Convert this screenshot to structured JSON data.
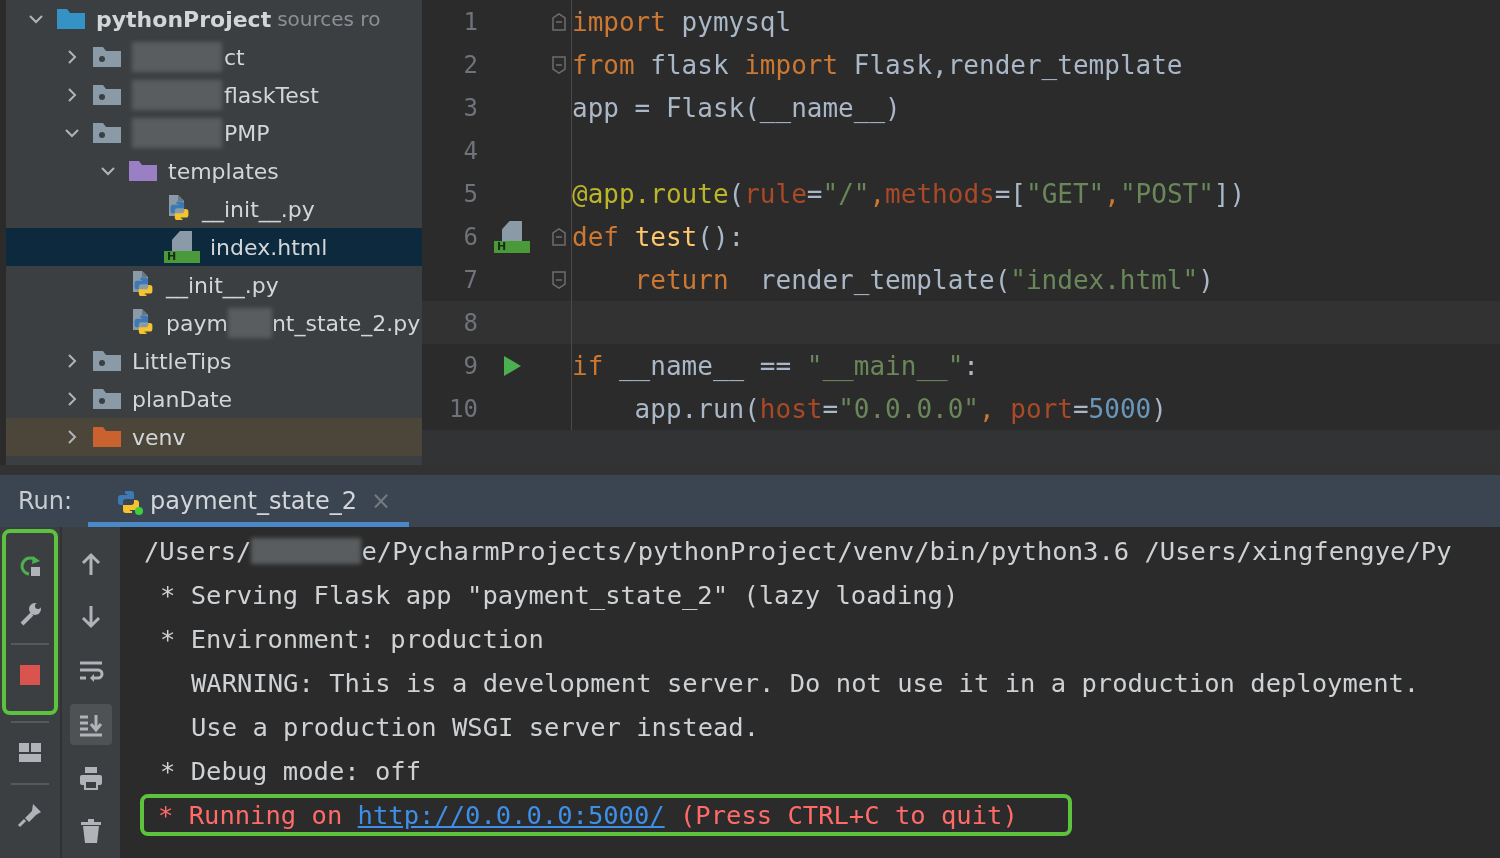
{
  "project_tree": {
    "items": [
      {
        "label": "pythonProject",
        "note": "sources ro",
        "kind": "root",
        "expanded": true,
        "selected": false,
        "children": [
          {
            "label": "ct",
            "kind": "module",
            "expanded": false,
            "selected": false,
            "blurred": true
          },
          {
            "label": "flaskTest",
            "kind": "module",
            "expanded": false,
            "selected": false,
            "blurred": true
          },
          {
            "label": "PMP",
            "kind": "module",
            "expanded": true,
            "selected": false,
            "blurred": true,
            "children": [
              {
                "label": "templates",
                "kind": "templates",
                "expanded": true,
                "selected": false,
                "children": [
                  {
                    "label": "__init__.py",
                    "kind": "python",
                    "selected": false
                  },
                  {
                    "label": "index.html",
                    "kind": "html",
                    "badge": "H",
                    "selected": true
                  }
                ]
              },
              {
                "label": "__init__.py",
                "kind": "python",
                "selected": false
              },
              {
                "label": "paym",
                "tail": "nt_state_2.py",
                "kind": "python",
                "selected": false,
                "blurred": true
              }
            ]
          },
          {
            "label": "LittleTips",
            "kind": "module",
            "expanded": false,
            "selected": false
          },
          {
            "label": "planDate",
            "kind": "module",
            "expanded": false,
            "selected": false
          },
          {
            "label": "venv",
            "kind": "excluded",
            "expanded": false,
            "selected": false
          }
        ]
      }
    ]
  },
  "editor": {
    "lines": [
      {
        "number": "1",
        "fold_start": true,
        "tokens": [
          {
            "kind": "kw",
            "text": "import"
          },
          {
            "kind": "plain",
            "text": " pymysql"
          }
        ]
      },
      {
        "number": "2",
        "fold_end": true,
        "tokens": [
          {
            "kind": "kw",
            "text": "from"
          },
          {
            "kind": "plain",
            "text": " flask "
          },
          {
            "kind": "kw",
            "text": "import"
          },
          {
            "kind": "plain",
            "text": " Flask,render_template"
          }
        ]
      },
      {
        "number": "3",
        "tokens": [
          {
            "kind": "plain",
            "text": "app = Flask(__name__)"
          }
        ]
      },
      {
        "number": "4"
      },
      {
        "number": "5",
        "tokens": [
          {
            "kind": "deco",
            "text": "@app.route"
          },
          {
            "kind": "plain",
            "text": "("
          },
          {
            "kind": "param",
            "text": "rule"
          },
          {
            "kind": "plain",
            "text": "="
          },
          {
            "kind": "str",
            "text": "\"/\""
          },
          {
            "kind": "kw",
            "text": ","
          },
          {
            "kind": "param",
            "text": "methods"
          },
          {
            "kind": "plain",
            "text": "=["
          },
          {
            "kind": "str",
            "text": "\"GET\""
          },
          {
            "kind": "kw",
            "text": ","
          },
          {
            "kind": "str",
            "text": "\"POST\""
          },
          {
            "kind": "plain",
            "text": "])"
          }
        ]
      },
      {
        "number": "6",
        "html_marker": true,
        "badge": "H",
        "fold_start": true,
        "tokens": [
          {
            "kind": "kw",
            "text": "def "
          },
          {
            "kind": "fn",
            "text": "test"
          },
          {
            "kind": "plain",
            "text": "():"
          }
        ]
      },
      {
        "number": "7",
        "fold_end": true,
        "indented": true,
        "tokens": [
          {
            "kind": "kw",
            "text": "return"
          },
          {
            "kind": "plain",
            "text": "  render_template("
          },
          {
            "kind": "str",
            "text": "\"index.html\""
          },
          {
            "kind": "plain",
            "text": ")"
          }
        ]
      },
      {
        "number": "8",
        "current": true
      },
      {
        "number": "9",
        "run_marker": true,
        "tokens": [
          {
            "kind": "kw",
            "text": "if"
          },
          {
            "kind": "plain",
            "text": " __name__ == "
          },
          {
            "kind": "str",
            "text": "\"__main__\""
          },
          {
            "kind": "plain",
            "text": ":"
          }
        ]
      },
      {
        "number": "10",
        "indented": true,
        "tokens": [
          {
            "kind": "plain",
            "text": "app.run("
          },
          {
            "kind": "param",
            "text": "host"
          },
          {
            "kind": "plain",
            "text": "="
          },
          {
            "kind": "str",
            "text": "\"0.0.0.0\""
          },
          {
            "kind": "kw",
            "text": ", "
          },
          {
            "kind": "param",
            "text": "port"
          },
          {
            "kind": "plain",
            "text": "="
          },
          {
            "kind": "num",
            "text": "5000"
          },
          {
            "kind": "plain",
            "text": ")"
          }
        ]
      }
    ]
  },
  "run_panel": {
    "label": "Run:",
    "tabs": [
      {
        "title": "payment_state_2",
        "close": "×",
        "selected": true
      }
    ],
    "toolbar": [
      {
        "kind": "rerun",
        "highlighted": true
      },
      {
        "kind": "settings",
        "highlighted": true
      },
      {
        "kind": "stop",
        "highlighted": true
      },
      {
        "kind": "layout",
        "highlighted": false
      },
      {
        "kind": "pin",
        "highlighted": false
      }
    ],
    "toolbar_2": [
      {
        "kind": "up",
        "selected": false
      },
      {
        "kind": "down",
        "selected": false
      },
      {
        "kind": "wrap",
        "selected": false
      },
      {
        "kind": "scroll-end",
        "selected": true
      },
      {
        "kind": "print",
        "selected": false
      },
      {
        "kind": "delete",
        "selected": false
      }
    ],
    "console": [
      {
        "kind": "path",
        "parts": [
          "/Users/",
          "e/PycharmProjects/pythonProject/venv/bin/python3.6 /Users/xingfengye/Py"
        ]
      },
      {
        "kind": "info",
        "text": "* Serving Flask app \"payment_state_2\" (lazy loading)"
      },
      {
        "kind": "info",
        "text": "* Environment: production"
      },
      {
        "kind": "warning",
        "text": "WARNING: This is a development server. Do not use it in a production deployment."
      },
      {
        "kind": "warning",
        "text": "Use a production WSGI server instead."
      },
      {
        "kind": "info",
        "text": "* Debug mode: off"
      },
      {
        "kind": "running",
        "highlighted": true,
        "text": "* Running on ",
        "link": "http://0.0.0.0:5000/",
        "suffix": " (Press CTRL+C to quit)"
      }
    ]
  }
}
